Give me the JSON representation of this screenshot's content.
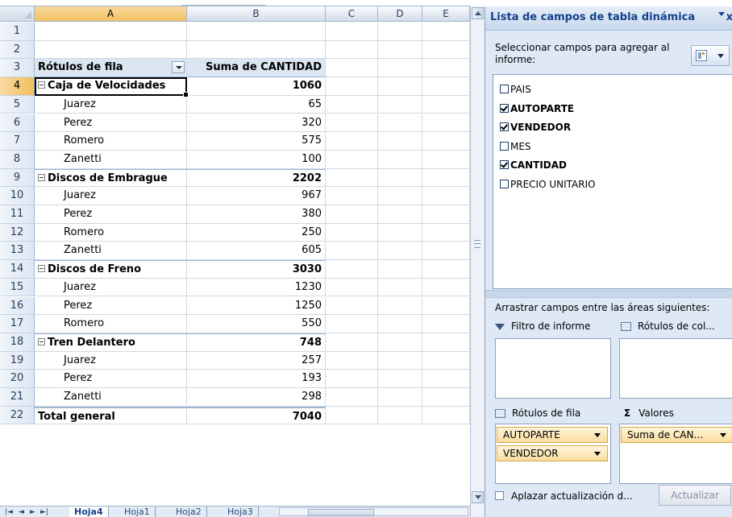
{
  "sheet": {
    "columns": [
      "A",
      "B",
      "C",
      "D",
      "E"
    ],
    "selected_column": "A",
    "active_row": "4",
    "rows": [
      {
        "n": "1",
        "a": "",
        "b": "",
        "kind": "empty"
      },
      {
        "n": "2",
        "a": "",
        "b": "",
        "kind": "empty"
      },
      {
        "n": "3",
        "a": "Rótulos de fila",
        "b": "Suma de CANTIDAD",
        "kind": "header"
      },
      {
        "n": "4",
        "a": "Caja de Velocidades",
        "b": "1060",
        "kind": "group"
      },
      {
        "n": "5",
        "a": "Juarez",
        "b": "65",
        "kind": "item"
      },
      {
        "n": "6",
        "a": "Perez",
        "b": "320",
        "kind": "item"
      },
      {
        "n": "7",
        "a": "Romero",
        "b": "575",
        "kind": "item"
      },
      {
        "n": "8",
        "a": "Zanetti",
        "b": "100",
        "kind": "item"
      },
      {
        "n": "9",
        "a": "Discos de Embrague",
        "b": "2202",
        "kind": "group"
      },
      {
        "n": "10",
        "a": "Juarez",
        "b": "967",
        "kind": "item"
      },
      {
        "n": "11",
        "a": "Perez",
        "b": "380",
        "kind": "item"
      },
      {
        "n": "12",
        "a": "Romero",
        "b": "250",
        "kind": "item"
      },
      {
        "n": "13",
        "a": "Zanetti",
        "b": "605",
        "kind": "item"
      },
      {
        "n": "14",
        "a": "Discos de Freno",
        "b": "3030",
        "kind": "group"
      },
      {
        "n": "15",
        "a": "Juarez",
        "b": "1230",
        "kind": "item"
      },
      {
        "n": "16",
        "a": "Perez",
        "b": "1250",
        "kind": "item"
      },
      {
        "n": "17",
        "a": "Romero",
        "b": "550",
        "kind": "item"
      },
      {
        "n": "18",
        "a": "Tren Delantero",
        "b": "748",
        "kind": "group"
      },
      {
        "n": "19",
        "a": "Juarez",
        "b": "257",
        "kind": "item"
      },
      {
        "n": "20",
        "a": "Perez",
        "b": "193",
        "kind": "item"
      },
      {
        "n": "21",
        "a": "Zanetti",
        "b": "298",
        "kind": "item"
      },
      {
        "n": "22",
        "a": "Total general",
        "b": "7040",
        "kind": "total"
      }
    ],
    "tabs": [
      "Hoja4",
      "Hoja1",
      "Hoja2",
      "Hoja3"
    ],
    "active_tab": "Hoja4",
    "nav_glyphs": [
      "|◄",
      "◄",
      "►",
      "►|"
    ]
  },
  "pane": {
    "title": "Lista de campos de tabla dinámica",
    "close": "x",
    "instruction": "Seleccionar campos para agregar al informe:",
    "fields": [
      {
        "label": "PAIS",
        "checked": false
      },
      {
        "label": "AUTOPARTE",
        "checked": true
      },
      {
        "label": "VENDEDOR",
        "checked": true
      },
      {
        "label": "MES",
        "checked": false
      },
      {
        "label": "CANTIDAD",
        "checked": true
      },
      {
        "label": "PRECIO UNITARIO",
        "checked": false
      }
    ],
    "drag_instruction": "Arrastrar campos entre las áreas siguientes:",
    "areas": {
      "report_filter": "Filtro de informe",
      "column_labels": "Rótulos de col...",
      "row_labels": "Rótulos de fila",
      "values": "Valores",
      "sigma": "Σ"
    },
    "row_pills": [
      "AUTOPARTE",
      "VENDEDOR"
    ],
    "value_pills": [
      "Suma de CAN..."
    ],
    "defer_label": "Aplazar actualización d...",
    "update_button": "Actualizar"
  }
}
